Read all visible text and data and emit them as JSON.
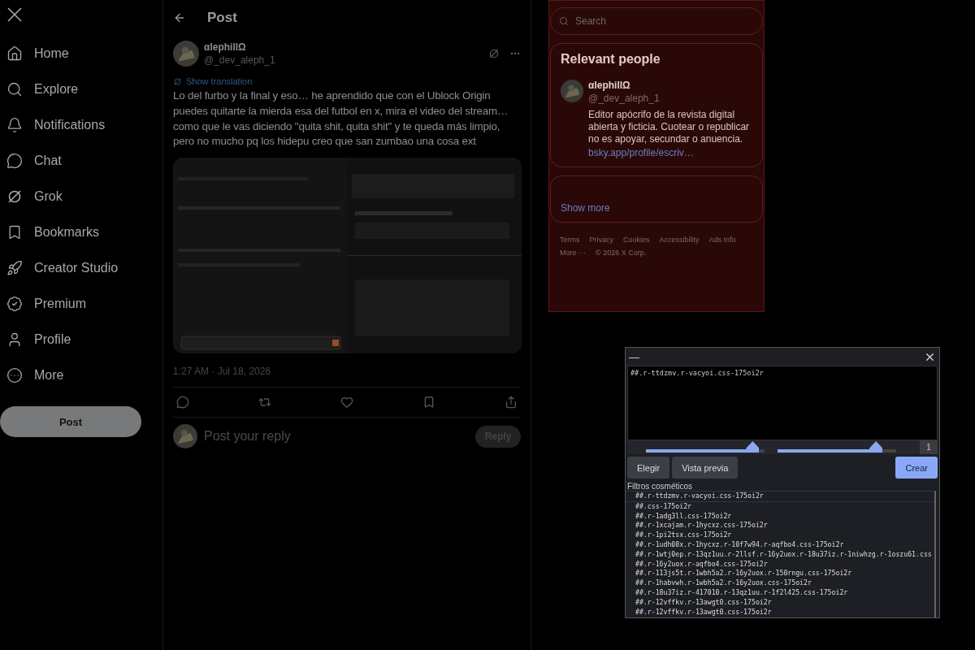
{
  "sidebar": {
    "items": [
      {
        "label": "Home"
      },
      {
        "label": "Explore"
      },
      {
        "label": "Notifications"
      },
      {
        "label": "Chat"
      },
      {
        "label": "Grok"
      },
      {
        "label": "Bookmarks"
      },
      {
        "label": "Creator Studio"
      },
      {
        "label": "Premium"
      },
      {
        "label": "Profile"
      },
      {
        "label": "More"
      }
    ],
    "post_button": "Post"
  },
  "main": {
    "title": "Post",
    "post": {
      "name": "αlephillΩ",
      "handle": "@_dev_aleph_1",
      "translation_link": "Show translation",
      "text": "Lo del furbo y la final y eso… he aprendido que con el Ublock Origin puedes quitarte la mierda esa del futbol en x, mira el video del stream… como que le vas diciendo \"quita shit, quita shit\" y te queda más limpio, pero no mucho pq los hidepu creo que san zumbao una cosa ext",
      "timestamp": "1:27 AM · Jul 18, 2026"
    },
    "reply": {
      "placeholder": "Post your reply",
      "button": "Reply"
    }
  },
  "right": {
    "search": {
      "placeholder": "Search"
    },
    "relevant_people": {
      "title": "Relevant people",
      "people": [
        {
          "name": "αlephillΩ",
          "handle": "@_dev_aleph_1",
          "bio": "Editor apócrifo de la revista digital abierta y ficticia. Cuotear o republicar no es apoyar, secundar o anuencia.",
          "link": "bsky.app/profile/escriv…"
        }
      ]
    },
    "show_more": "Show more",
    "footer": [
      "Terms",
      "Privacy",
      "Cookies",
      "Accessibility",
      "Ads Info",
      "More ···",
      "© 2026 X Corp."
    ]
  },
  "picker": {
    "minimize": "—",
    "editor_text": "##.r-ttdzmv.r-vacyoi.css-175oi2r",
    "sliders": [
      {
        "level": 0.9
      },
      {
        "level": 0.83
      }
    ],
    "count": "1",
    "buttons": [
      {
        "label": "Elegir",
        "primary": false
      },
      {
        "label": "Vista previa",
        "primary": false
      },
      {
        "label": "Crear",
        "primary": true
      }
    ],
    "list_title": "Filtros cosméticos",
    "filters": [
      {
        "text": "##.r-ttdzmv.r-vacyoi.css-175oi2r",
        "selected": true
      },
      {
        "text": "##.css-175oi2r",
        "selected": false
      },
      {
        "text": "##.r-1adg3ll.css-175oi2r",
        "selected": false
      },
      {
        "text": "##.r-1xcajam.r-1hycxz.css-175oi2r",
        "selected": false
      },
      {
        "text": "##.r-1pi2tsx.css-175oi2r",
        "selected": false
      },
      {
        "text": "##.r-1udh08x.r-1hycxz.r-10f7w94.r-aqfbo4.css-175oi2r",
        "selected": false
      },
      {
        "text": "##.r-1wtj0ep.r-13qz1uu.r-2llsf.r-16y2uox.r-18u37iz.r-1niwhzg.r-1oszu61.css",
        "selected": false
      },
      {
        "text": "##.r-16y2uox.r-aqfbo4.css-175oi2r",
        "selected": false
      },
      {
        "text": "##.r-113js5t.r-1wbh5a2.r-16y2uox.r-150rngu.css-175oi2r",
        "selected": false
      },
      {
        "text": "##.r-1habvwh.r-1wbh5a2.r-16y2uox.css-175oi2r",
        "selected": false
      },
      {
        "text": "##.r-18u37iz.r-417010.r-13qz1uu.r-1f2l425.css-175oi2r",
        "selected": false
      },
      {
        "text": "##.r-12vffkv.r-13awgt0.css-175oi2r",
        "selected": false
      },
      {
        "text": "##.r-12vffkv.r-13awgt0.css-175oi2r",
        "selected": false
      }
    ]
  }
}
